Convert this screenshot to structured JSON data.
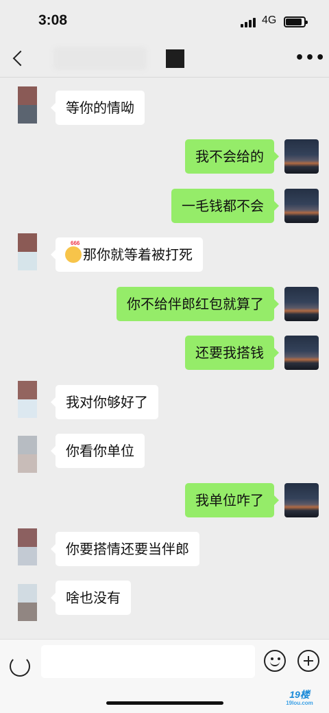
{
  "status_bar": {
    "time": "3:08",
    "network": "4G",
    "battery_level": 0.95
  },
  "nav": {
    "back_icon": "chevron-left-icon",
    "more_label": "•••"
  },
  "messages": [
    {
      "side": "in",
      "text": "等你的情呦",
      "avatar": [
        "#8a5a56",
        "#5b6470"
      ]
    },
    {
      "side": "out",
      "text": "我不会给的"
    },
    {
      "side": "out",
      "text": "一毛钱都不会"
    },
    {
      "side": "in",
      "text": "那你就等着被打死",
      "emoji": "thinking-666-emoji",
      "avatar": [
        "#8b5a55",
        "#d6e4ea"
      ]
    },
    {
      "side": "out",
      "text": "你不给伴郎红包就算了"
    },
    {
      "side": "out",
      "text": "还要我搭钱"
    },
    {
      "side": "in",
      "text": "我对你够好了",
      "avatar": [
        "#93645f",
        "#dce8f0"
      ]
    },
    {
      "side": "in",
      "text": "你看你单位",
      "avatar": [
        "#b7bcc2",
        "#c8bcb8"
      ]
    },
    {
      "side": "out",
      "text": "我单位咋了"
    },
    {
      "side": "in",
      "text": "你要搭情还要当伴郎",
      "avatar": [
        "#8c6060",
        "#c3cad3"
      ]
    },
    {
      "side": "in",
      "text": "啥也没有",
      "avatar": [
        "#d1dbe2",
        "#918682"
      ]
    }
  ],
  "input_bar": {
    "placeholder": ""
  },
  "watermark": {
    "logo": "19楼",
    "site": "19lou.com"
  }
}
